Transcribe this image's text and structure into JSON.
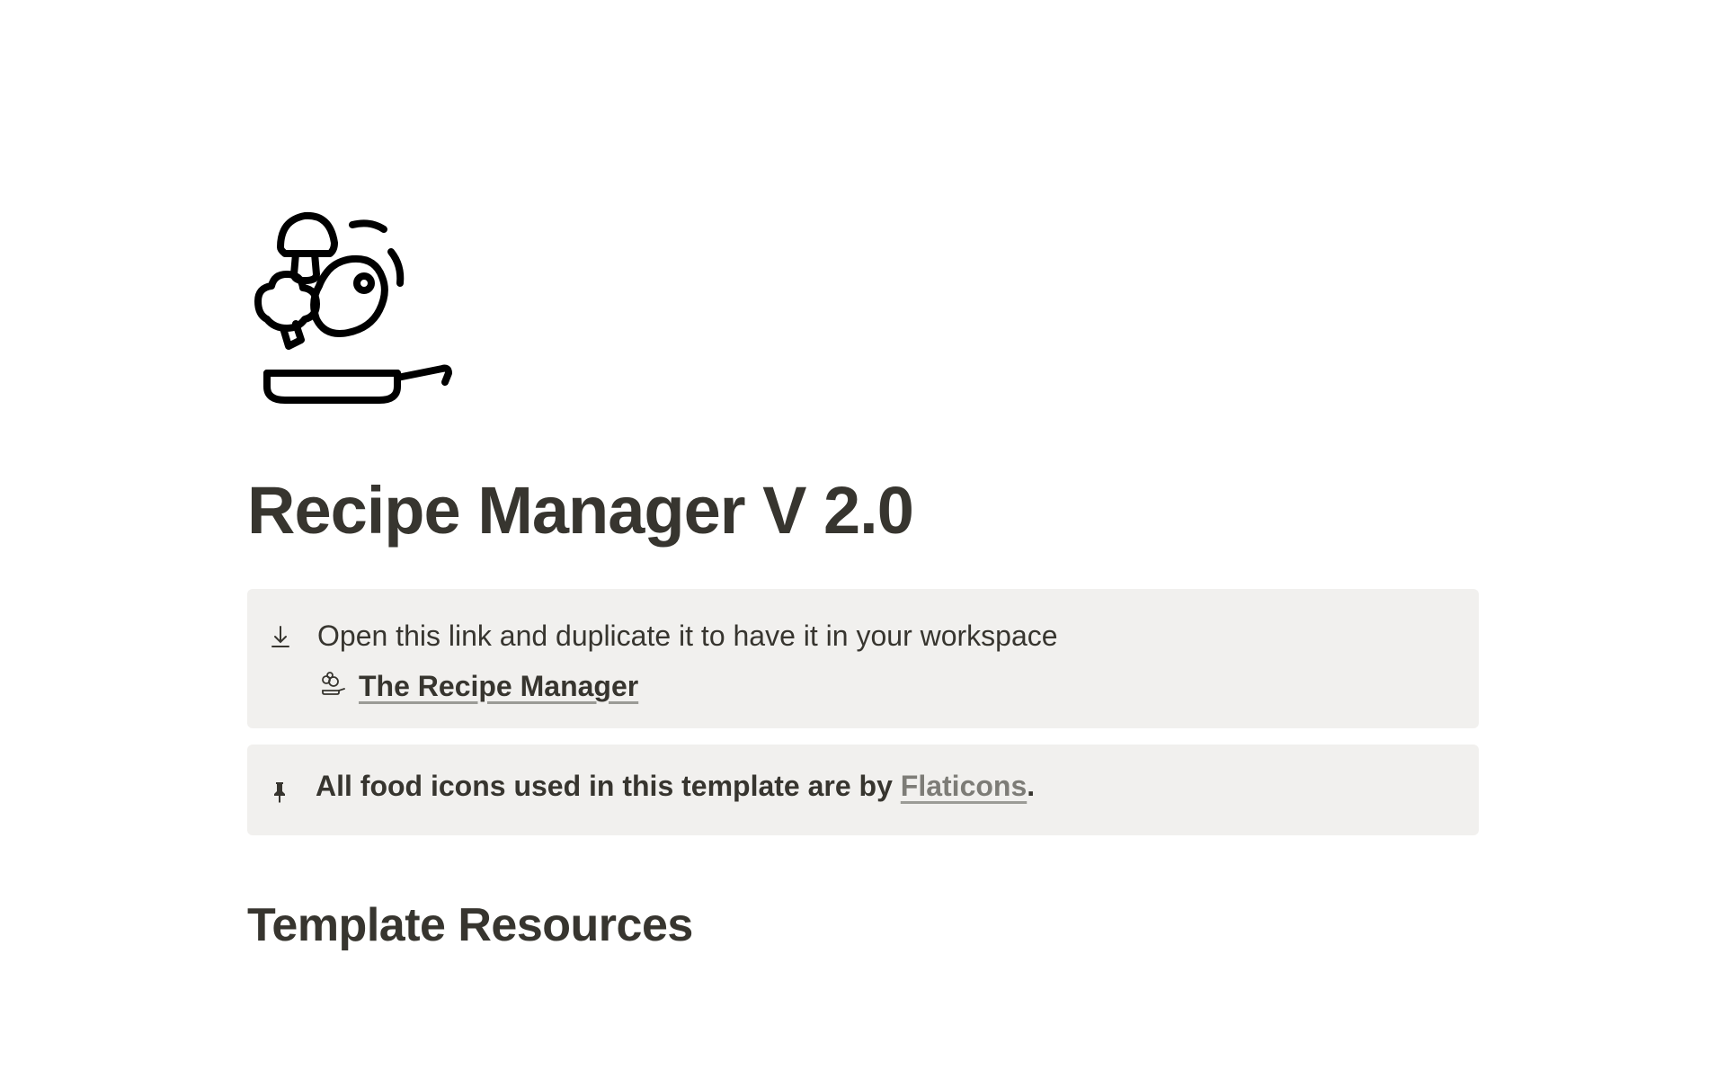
{
  "page": {
    "title": "Recipe Manager V 2.0"
  },
  "callouts": {
    "download": {
      "text": "Open this link and duplicate it to have it in your workspace",
      "link_label": "The Recipe Manager"
    },
    "attribution": {
      "text_before": "All food icons used in this template are by ",
      "link_label": "Flaticons",
      "text_after": "."
    }
  },
  "sections": {
    "resources_heading": "Template Resources"
  }
}
